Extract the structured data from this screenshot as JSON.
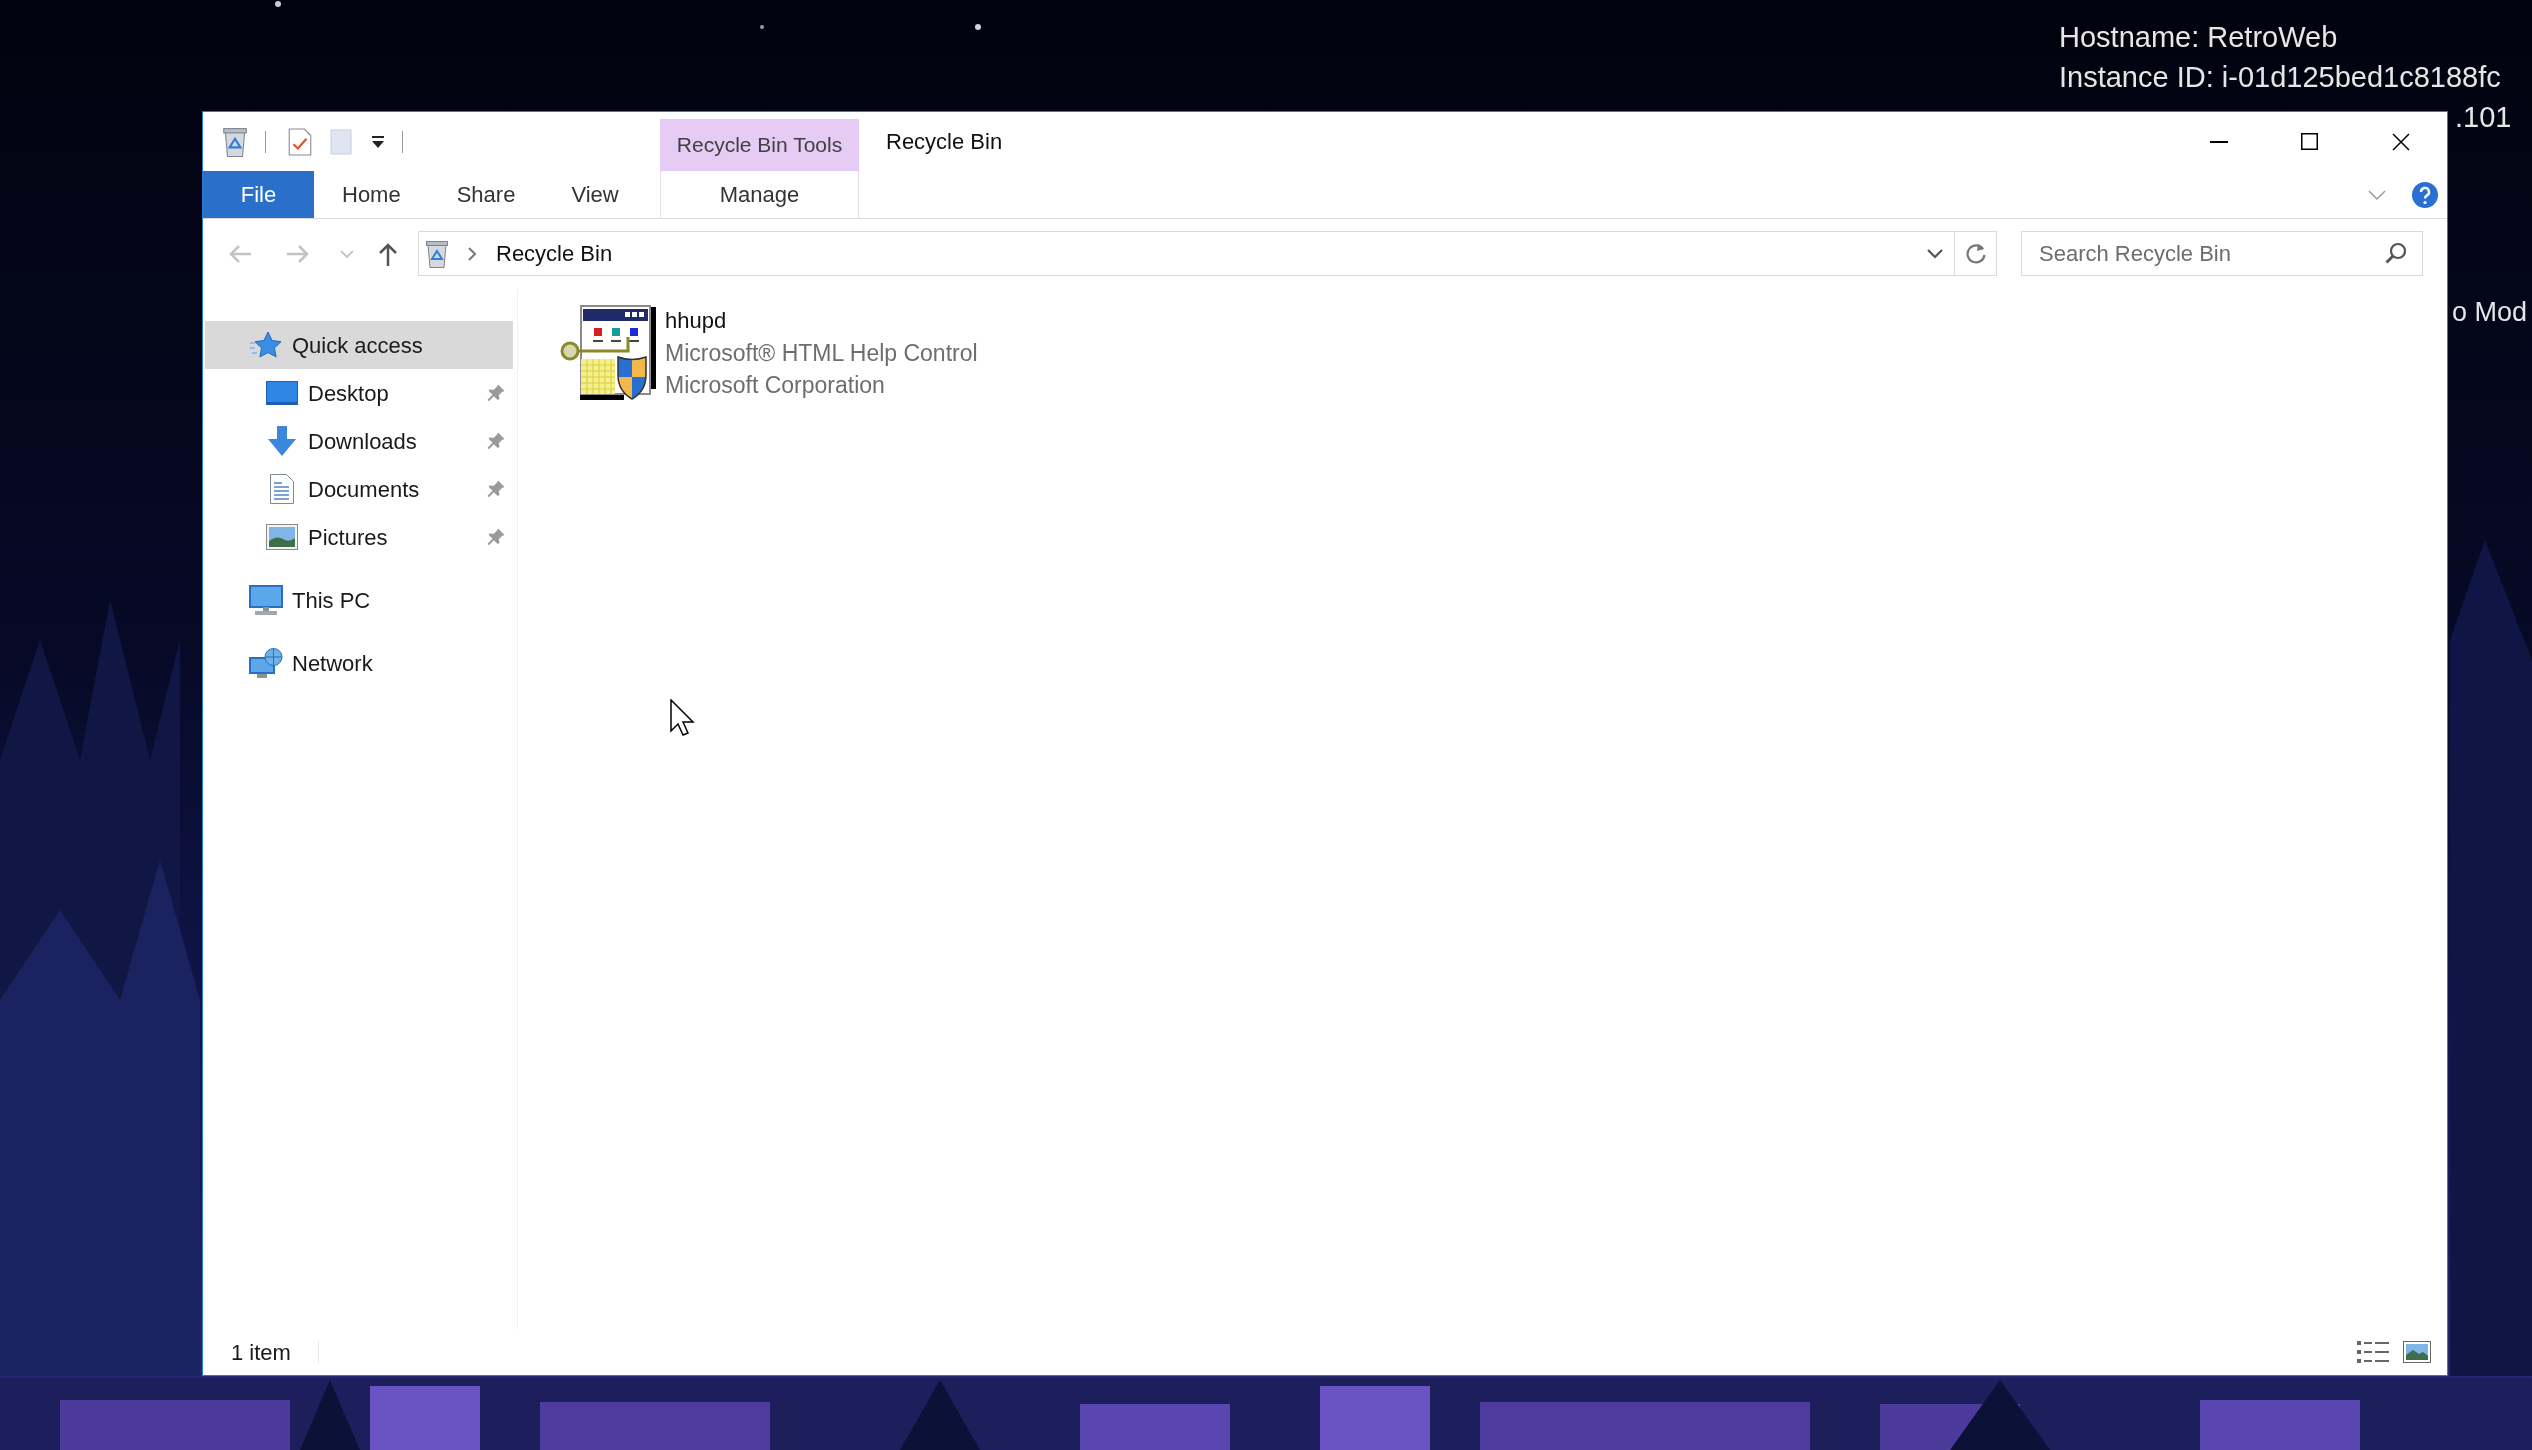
{
  "desktop": {
    "info_lines": [
      "Hostname: RetroWeb",
      "Instance ID: i-01d125bed1c8188fc",
      ".101"
    ],
    "edge_text": "o Mod"
  },
  "window": {
    "title": "Recycle Bin"
  },
  "ribbon": {
    "contextual_group": "Recycle Bin Tools",
    "tabs": [
      {
        "label": "File",
        "kind": "file",
        "selected": false
      },
      {
        "label": "Home",
        "kind": "standard",
        "selected": false
      },
      {
        "label": "Share",
        "kind": "standard",
        "selected": false
      },
      {
        "label": "View",
        "kind": "standard",
        "selected": false
      },
      {
        "label": "Manage",
        "kind": "contextual",
        "selected": false
      }
    ]
  },
  "address_bar": {
    "breadcrumbs": [
      "Recycle Bin"
    ]
  },
  "search_box": {
    "placeholder": "Search Recycle Bin"
  },
  "navigation_pane": {
    "items": [
      {
        "label": "Quick access",
        "kind": "star",
        "selected": true,
        "children": [
          {
            "label": "Desktop",
            "kind": "desktop",
            "selected": false,
            "pinned": true
          },
          {
            "label": "Downloads",
            "kind": "downloads",
            "selected": false,
            "pinned": true
          },
          {
            "label": "Documents",
            "kind": "documents",
            "selected": false,
            "pinned": true
          },
          {
            "label": "Pictures",
            "kind": "pictures",
            "selected": false,
            "pinned": true
          }
        ]
      },
      {
        "label": "This PC",
        "kind": "computer",
        "selected": false
      },
      {
        "label": "Network",
        "kind": "network",
        "selected": false
      }
    ]
  },
  "files": [
    {
      "name": "hhupd",
      "description": "Microsoft® HTML Help Control",
      "company": "Microsoft Corporation"
    }
  ],
  "status_bar": {
    "item_count": "1 item"
  }
}
